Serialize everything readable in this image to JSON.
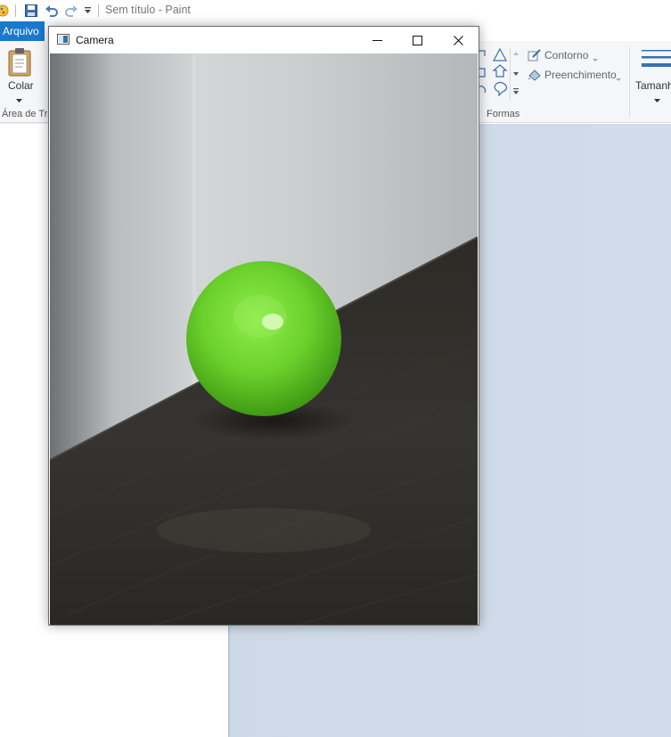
{
  "paint": {
    "title": "Sem título - Paint",
    "tab_file": "Arquivo",
    "clipboard": {
      "paste_label": "Colar",
      "group_label": "Área de Tra"
    },
    "shapes": {
      "outline_label": "Contorno",
      "fill_label": "Preenchimento",
      "group_label": "Formas"
    },
    "size_label": "Tamanh"
  },
  "camera_window": {
    "title": "Camera",
    "controls": {
      "minimize": "minimize",
      "maximize": "maximize",
      "close": "close"
    },
    "feed_subject": "green-ball-on-dark-wooden-table"
  },
  "colors": {
    "file_tab": "#1979ca",
    "ribbon_bg": "#f5f6f7",
    "canvas_area": "#cfdae8",
    "ball_green": "#6cd12c",
    "table_dark": "#2b2824",
    "wall_gray": "#c9cccd"
  }
}
